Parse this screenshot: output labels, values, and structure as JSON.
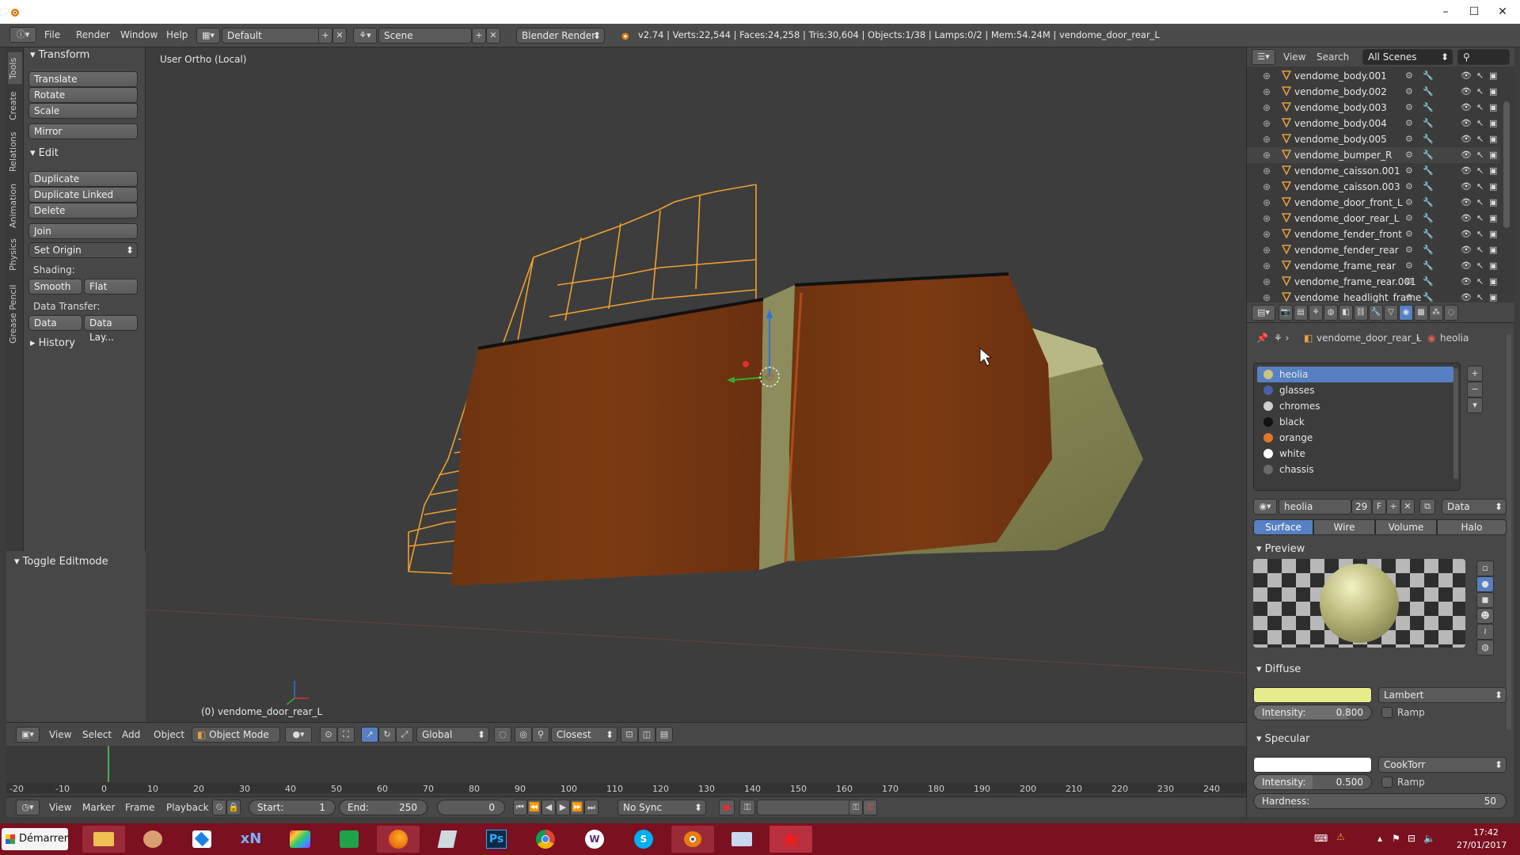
{
  "window": {
    "minimize": "–",
    "maximize": "☐",
    "close": "✕"
  },
  "menubar": {
    "menus": [
      "File",
      "Render",
      "Window",
      "Help"
    ],
    "layout": "Default",
    "scene": "Scene",
    "engine": "Blender Render",
    "stats": "v2.74 | Verts:22,544 | Faces:24,258 | Tris:30,604 | Objects:1/38 | Lamps:0/2 | Mem:54.24M | vendome_door_rear_L"
  },
  "toolshelf": {
    "tabs": [
      "Tools",
      "Create",
      "Relations",
      "Animation",
      "Physics",
      "Grease Pencil"
    ],
    "transform_title": "Transform",
    "transform_buttons": [
      "Translate",
      "Rotate",
      "Scale"
    ],
    "mirror": "Mirror",
    "edit_title": "Edit",
    "edit_buttons": [
      "Duplicate",
      "Duplicate Linked",
      "Delete"
    ],
    "join": "Join",
    "set_origin": "Set Origin",
    "shading_label": "Shading:",
    "smooth": "Smooth",
    "flat": "Flat",
    "data_transfer_label": "Data Transfer:",
    "data": "Data",
    "data_layout": "Data Lay...",
    "history": "History",
    "toggle_editmode": "Toggle Editmode"
  },
  "viewport": {
    "view_name": "User Ortho (Local)",
    "object_label": "(0) vendome_door_rear_L"
  },
  "view_header": {
    "menus": [
      "View",
      "Select",
      "Add",
      "Object"
    ],
    "mode": "Object Mode",
    "orientation": "Global",
    "snap": "Closest"
  },
  "timeline": {
    "ruler": [
      "-20",
      "-10",
      "0",
      "10",
      "20",
      "30",
      "40",
      "50",
      "60",
      "70",
      "80",
      "90",
      "100",
      "110",
      "120",
      "130",
      "140",
      "150",
      "160",
      "170",
      "180",
      "190",
      "200",
      "210",
      "220",
      "230",
      "240"
    ],
    "menus": [
      "View",
      "Marker",
      "Frame",
      "Playback"
    ],
    "start_label": "Start:",
    "start_value": "1",
    "end_label": "End:",
    "end_value": "250",
    "current": "0",
    "sync": "No Sync"
  },
  "outliner": {
    "menus": [
      "View",
      "Search"
    ],
    "filter": "All Scenes",
    "rows": [
      "vendome_body.001",
      "vendome_body.002",
      "vendome_body.003",
      "vendome_body.004",
      "vendome_body.005",
      "vendome_bumper_R",
      "vendome_caisson.001",
      "vendome_caisson.003",
      "vendome_door_front_L",
      "vendome_door_rear_L",
      "vendome_fender_front",
      "vendome_fender_rear",
      "vendome_frame_rear",
      "vendome_frame_rear.001",
      "vendome_headlight_frame"
    ]
  },
  "properties": {
    "breadcrumb_object": "vendome_door_rear_L",
    "breadcrumb_material": "heolia",
    "materials": [
      {
        "name": "heolia",
        "color": "#c8c67a"
      },
      {
        "name": "glasses",
        "color": "#4a5fa8"
      },
      {
        "name": "chromes",
        "color": "#cfcfcf"
      },
      {
        "name": "black",
        "color": "#111111"
      },
      {
        "name": "orange",
        "color": "#e0762a"
      },
      {
        "name": "white",
        "color": "#ffffff"
      },
      {
        "name": "chassis",
        "color": "#6a6a6a"
      }
    ],
    "material_name": "heolia",
    "users": "29",
    "fake": "F",
    "link": "Data",
    "tabs": [
      "Surface",
      "Wire",
      "Volume",
      "Halo"
    ],
    "preview_title": "Preview",
    "diffuse_title": "Diffuse",
    "diffuse_color": "#e6ec8c",
    "diffuse_shader": "Lambert",
    "diffuse_intensity_label": "Intensity:",
    "diffuse_intensity": "0.800",
    "ramp": "Ramp",
    "specular_title": "Specular",
    "specular_shader": "CookTorr",
    "specular_intensity_label": "Intensity:",
    "specular_intensity": "0.500",
    "hardness_label": "Hardness:",
    "hardness": "50"
  },
  "taskbar": {
    "start": "Démarrer",
    "time": "17:42",
    "date": "27/01/2017"
  }
}
